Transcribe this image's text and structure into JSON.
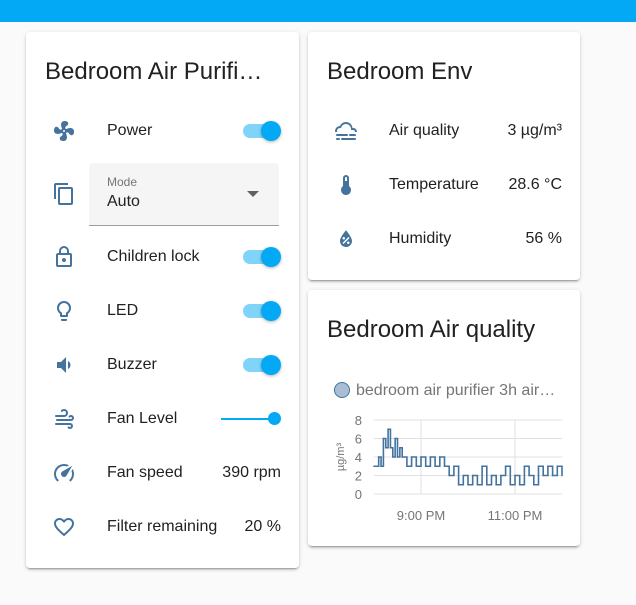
{
  "purifier": {
    "title": "Bedroom Air Purifi…",
    "power_label": "Power",
    "mode": {
      "label": "Mode",
      "value": "Auto"
    },
    "children_lock_label": "Children lock",
    "led_label": "LED",
    "buzzer_label": "Buzzer",
    "fan_level_label": "Fan Level",
    "fan_speed": {
      "label": "Fan speed",
      "value": "390 rpm"
    },
    "filter": {
      "label": "Filter remaining",
      "value": "20 %"
    }
  },
  "env": {
    "title": "Bedroom Env",
    "air_quality": {
      "label": "Air quality",
      "value": "3 µg/m³"
    },
    "temperature": {
      "label": "Temperature",
      "value": "28.6 °C"
    },
    "humidity": {
      "label": "Humidity",
      "value": "56 %"
    }
  },
  "history": {
    "title": "Bedroom Air quality",
    "legend": "bedroom air purifier 3h air…"
  },
  "colors": {
    "accent": "#03a9f4",
    "icon": "#44739e",
    "series": "#44739e"
  },
  "chart_data": {
    "type": "line",
    "ylabel": "µg/m³",
    "ylim": [
      0,
      8
    ],
    "yticks": [
      "0",
      "2",
      "4",
      "6",
      "8"
    ],
    "xticks": [
      "9:00 PM",
      "11:00 PM"
    ],
    "series": [
      {
        "name": "bedroom air purifier 3h air…",
        "x_hours": [
          20.0,
          20.1,
          20.15,
          20.2,
          20.25,
          20.3,
          20.35,
          20.4,
          20.45,
          20.5,
          20.55,
          20.6,
          20.7,
          20.8,
          20.9,
          21.0,
          21.1,
          21.2,
          21.3,
          21.4,
          21.5,
          21.6,
          21.7,
          21.8,
          21.9,
          22.0,
          22.1,
          22.2,
          22.3,
          22.4,
          22.5,
          22.6,
          22.7,
          22.8,
          22.9,
          23.0,
          23.1,
          23.2,
          23.3,
          23.4,
          23.5,
          23.6,
          23.7,
          23.8,
          23.9,
          24.0
        ],
        "values": [
          3,
          4,
          3,
          6,
          5,
          7,
          5,
          4,
          6,
          4,
          5,
          4,
          3,
          4,
          3,
          4,
          3,
          4,
          3,
          4,
          3,
          2,
          3,
          1,
          2,
          1,
          2,
          1,
          3,
          1,
          2,
          1,
          2,
          3,
          1,
          2,
          1,
          3,
          2,
          1,
          3,
          2,
          3,
          2,
          3,
          2
        ]
      }
    ]
  }
}
